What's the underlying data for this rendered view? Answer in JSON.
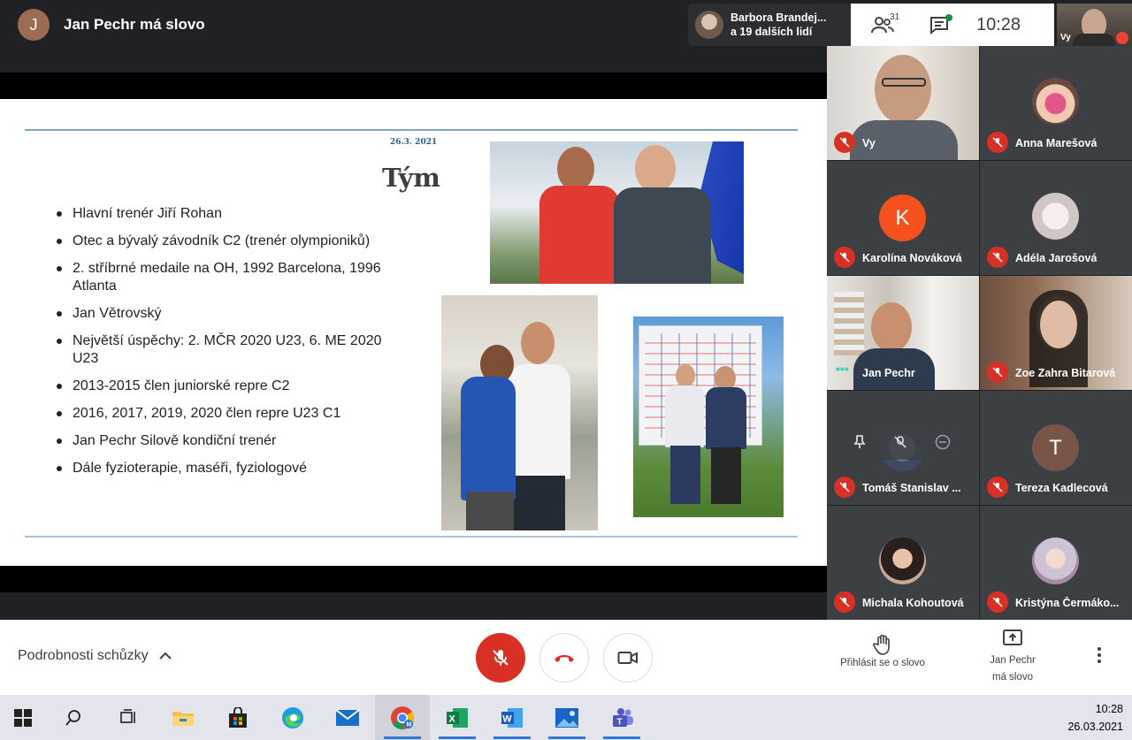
{
  "header": {
    "presenter_initial": "J",
    "presenter_title": "Jan Pechr má slovo",
    "others_name": "Barbora Brandej...",
    "others_more": "a 19 dalších lidí",
    "people_count": "31",
    "time": "10:28",
    "self_label": "Vy"
  },
  "slide": {
    "date": "26.3. 2021",
    "title": "Tým",
    "bullets": [
      "Hlavní trenér  Jiří Rohan",
      "Otec a bývalý závodník C2 (trenér olympioniků)",
      "2. stříbrné medaile na OH, 1992 Barcelona, 1996 Atlanta",
      "Jan Větrovský",
      "Největší úspěchy: 2. MČR 2020 U23, 6. ME 2020 U23",
      "2013-2015 člen juniorské repre C2",
      "2016, 2017, 2019, 2020 člen repre U23 C1",
      "Jan Pechr Silově kondiční trenér",
      "Dále fyzioterapie, maséři, fyziologové"
    ]
  },
  "participants": [
    {
      "name": "Vy",
      "kind": "video"
    },
    {
      "name": "Anna Marešová",
      "kind": "photo",
      "color": "#d8507a"
    },
    {
      "name": "Karolína Nováková",
      "kind": "initial",
      "initial": "K",
      "color": "#f4511e"
    },
    {
      "name": "Adéla Jarošová",
      "kind": "photo",
      "color": "#d9d2d0"
    },
    {
      "name": "Jan Pechr",
      "kind": "video"
    },
    {
      "name": "Zoe Zahra Bitarová",
      "kind": "video"
    },
    {
      "name": "Tomáš Stanislav ...",
      "kind": "photo",
      "color": "#5a6d8a"
    },
    {
      "name": "Tereza Kadlecová",
      "kind": "initial",
      "initial": "T",
      "color": "#795548"
    },
    {
      "name": "Michala Kohoutová",
      "kind": "photo",
      "color": "#a68a7a"
    },
    {
      "name": "Kristýna Čermáko...",
      "kind": "photo",
      "color": "#c7b7c8"
    }
  ],
  "controls": {
    "meeting_details": "Podrobnosti schůzky",
    "raise_hand": "Přihlásit se o slovo",
    "presenting_line1": "Jan Pechr",
    "presenting_line2": "má slovo"
  },
  "taskbar": {
    "apps": [
      "windows-start",
      "search",
      "task-view",
      "file-explorer",
      "store",
      "edge",
      "mail",
      "chrome",
      "excel",
      "word",
      "photos",
      "teams"
    ],
    "time": "10:28",
    "date": "26.03.2021"
  },
  "colors": {
    "red": "#d93025",
    "dark": "#202124",
    "tile": "#3c4043"
  }
}
